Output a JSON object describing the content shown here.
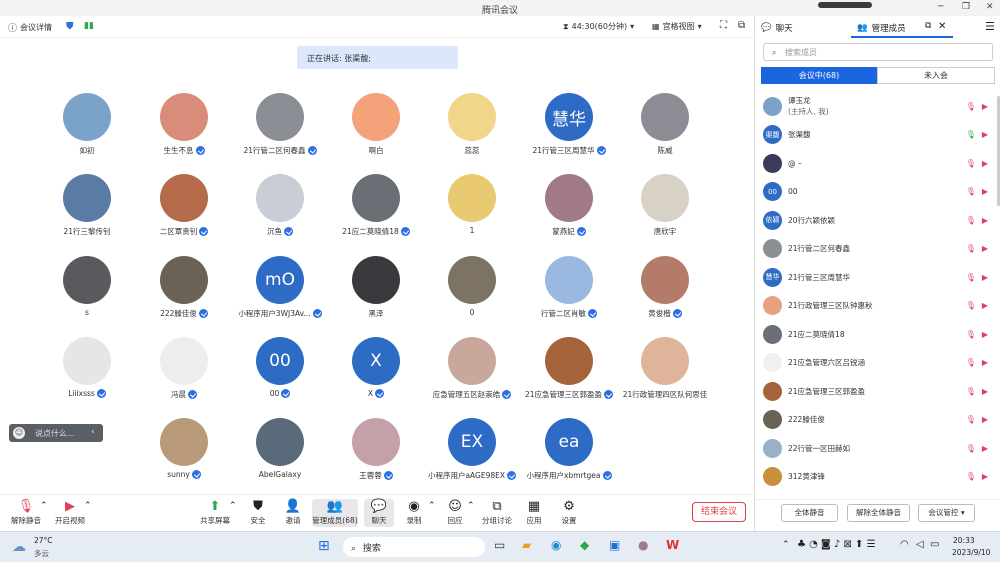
{
  "window": {
    "title": "腾讯会议"
  },
  "topbar": {
    "meeting_info": "会议详情",
    "timer": "44:30(60分钟)",
    "view_mode": "宫格视图"
  },
  "speaking_banner": "正在讲话: 张渠馥;",
  "participants": [
    {
      "name": "如初",
      "verified": false,
      "initials": "",
      "color": "#7ba3c9"
    },
    {
      "name": "生生不息",
      "verified": true,
      "initials": "",
      "color": "#d98c7a"
    },
    {
      "name": "21行管二区何春鑫",
      "verified": true,
      "initials": "",
      "color": "#8a8f96"
    },
    {
      "name": "啊白",
      "verified": false,
      "initials": "",
      "color": "#f4a27a"
    },
    {
      "name": "蕊蕊",
      "verified": false,
      "initials": "",
      "color": "#f0d58a"
    },
    {
      "name": "21行管三区周慧华",
      "verified": true,
      "initials": "慧华",
      "color": "#2e6bc4"
    },
    {
      "name": "陈威",
      "verified": false,
      "initials": "",
      "color": "#8c8c94"
    },
    {
      "name": "21行三黎传钊",
      "verified": false,
      "initials": "",
      "color": "#5a7ba6"
    },
    {
      "name": "二区覃贵钊",
      "verified": true,
      "initials": "",
      "color": "#b56a4a"
    },
    {
      "name": "沉鱼",
      "verified": true,
      "initials": "",
      "color": "#c9ced6"
    },
    {
      "name": "21应二莫晓倩18",
      "verified": true,
      "initials": "",
      "color": "#6a6e75"
    },
    {
      "name": "1",
      "verified": false,
      "initials": "",
      "color": "#e8c870"
    },
    {
      "name": "蒙燕妃",
      "verified": true,
      "initials": "",
      "color": "#a07a86"
    },
    {
      "name": "唐欣宇",
      "verified": false,
      "initials": "",
      "color": "#d8d2c6"
    },
    {
      "name": "s",
      "verified": false,
      "initials": "",
      "color": "#5a5a5e"
    },
    {
      "name": "222滕佳俊",
      "verified": true,
      "initials": "",
      "color": "#6a6256"
    },
    {
      "name": "小程序用户3WJ3Av...",
      "verified": true,
      "initials": "mO",
      "color": "#2e6bc4"
    },
    {
      "name": "黑泽",
      "verified": false,
      "initials": "",
      "color": "#3a3a3e"
    },
    {
      "name": "0",
      "verified": false,
      "initials": "",
      "color": "#7d7362"
    },
    {
      "name": "行管二区肖敏",
      "verified": true,
      "initials": "",
      "color": "#9ab8e0"
    },
    {
      "name": "黄俊楷",
      "verified": true,
      "initials": "",
      "color": "#b47a6a"
    },
    {
      "name": "Liiixsss",
      "verified": true,
      "initials": "",
      "color": "#e6e6e6"
    },
    {
      "name": "冯晨",
      "verified": true,
      "initials": "",
      "color": "#ededed"
    },
    {
      "name": "00",
      "verified": true,
      "initials": "00",
      "color": "#2e6bc4"
    },
    {
      "name": "X",
      "verified": true,
      "initials": "X",
      "color": "#2e6bc4"
    },
    {
      "name": "应急管理五区赵崇皓",
      "verified": true,
      "initials": "",
      "color": "#c8a89a"
    },
    {
      "name": "21应急管理三区郭盈盈",
      "verified": true,
      "initials": "",
      "color": "#a5633c"
    },
    {
      "name": "21行政管理四区队何思佳",
      "verified": false,
      "initials": "",
      "color": "#e0b49a"
    },
    {
      "name": "sunny",
      "verified": true,
      "initials": "",
      "color": "#b89a7a"
    },
    {
      "name": "AbelGalaxy",
      "verified": false,
      "initials": "",
      "color": "#5a6a7a"
    },
    {
      "name": "王蓉蓉",
      "verified": true,
      "initials": "",
      "color": "#c4a0a8"
    },
    {
      "name": "小程序用户aAGE98EX",
      "verified": true,
      "initials": "EX",
      "color": "#2e6bc4"
    },
    {
      "name": "小程序用户xbmrtgea",
      "verified": true,
      "initials": "ea",
      "color": "#2e6bc4"
    }
  ],
  "chat_input": {
    "placeholder": "说点什么..."
  },
  "bottombar": {
    "mute": "解除静音",
    "video": "开启视频",
    "share": "共享屏幕",
    "security": "安全",
    "invite": "邀请",
    "members": "管理成员(68)",
    "chat": "聊天",
    "record": "录制",
    "reactions": "回应",
    "breakout": "分组讨论",
    "apps": "应用",
    "settings": "设置",
    "end": "结束会议"
  },
  "right_panel": {
    "tab_chat": "聊天",
    "tab_members": "管理成员",
    "search_placeholder": "搜索成员",
    "seg_in": "会议中(68)",
    "seg_out": "未入会",
    "members": [
      {
        "name": "谭玉龙",
        "sub": "(主持人, 我)",
        "initials": "",
        "color": "#7ba3c9",
        "mic_on": false
      },
      {
        "name": "张渠馥",
        "sub": "",
        "initials": "渠馥",
        "color": "#2e6bc4",
        "mic_on": true
      },
      {
        "name": "@ –",
        "sub": "",
        "initials": "",
        "color": "#3a3a5a",
        "mic_on": false
      },
      {
        "name": "00",
        "sub": "",
        "initials": "00",
        "color": "#2e6bc4",
        "mic_on": false
      },
      {
        "name": "20行六颖依颖",
        "sub": "",
        "initials": "依颖",
        "color": "#2e6bc4",
        "mic_on": false
      },
      {
        "name": "21行管二区何春鑫",
        "sub": "",
        "initials": "",
        "color": "#8a8f96",
        "mic_on": false
      },
      {
        "name": "21行管三区周慧华",
        "sub": "",
        "initials": "慧华",
        "color": "#2e6bc4",
        "mic_on": false
      },
      {
        "name": "21行政管理三区队钟惠秋",
        "sub": "",
        "initials": "",
        "color": "#e8a080",
        "mic_on": false
      },
      {
        "name": "21应二莫晓倩18",
        "sub": "",
        "initials": "",
        "color": "#6a6e75",
        "mic_on": false
      },
      {
        "name": "21应急管理六区吕锐涵",
        "sub": "",
        "initials": "",
        "color": "#f0f0f0",
        "mic_on": false
      },
      {
        "name": "21应急管理三区郭盈盈",
        "sub": "",
        "initials": "",
        "color": "#a5633c",
        "mic_on": false
      },
      {
        "name": "222滕佳俊",
        "sub": "",
        "initials": "",
        "color": "#6a6256",
        "mic_on": false
      },
      {
        "name": "22行管一区田赫如",
        "sub": "",
        "initials": "",
        "color": "#9ab0c8",
        "mic_on": false
      },
      {
        "name": "312黄津锋",
        "sub": "",
        "initials": "",
        "color": "#c8903a",
        "mic_on": false
      }
    ],
    "mute_all": "全体静音",
    "unmute_all": "解除全体静音",
    "controls": "会议管控"
  },
  "taskbar": {
    "temp": "27°C",
    "weather": "多云",
    "search": "搜索",
    "time": "20:33",
    "date": "2023/9/10"
  }
}
